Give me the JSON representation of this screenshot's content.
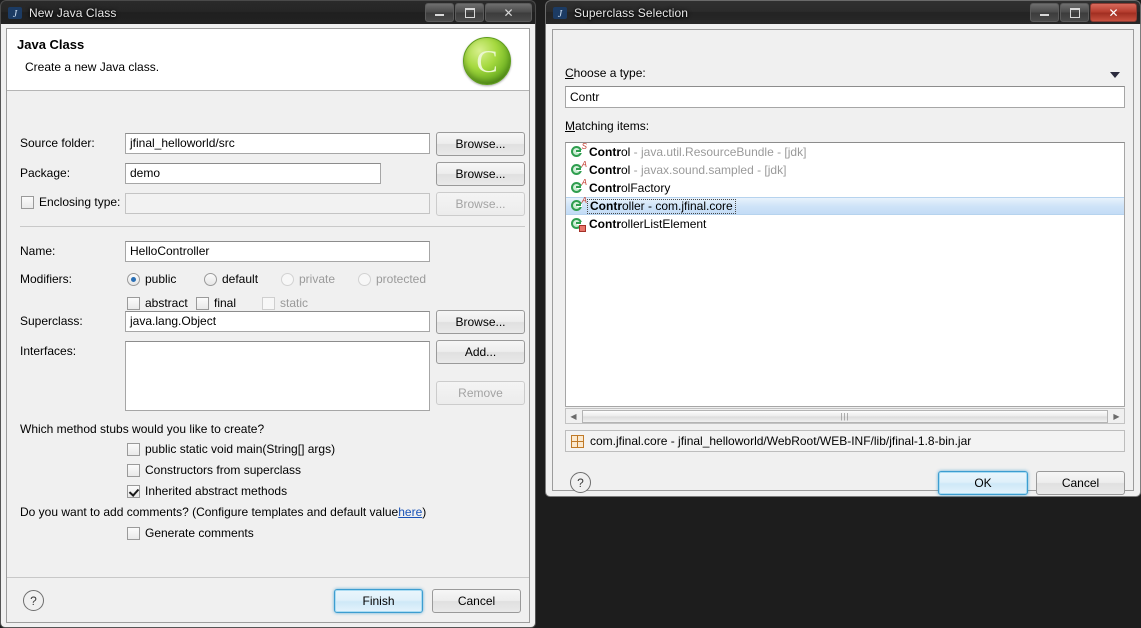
{
  "new_class_dialog": {
    "title": "New Java Class",
    "window_icon": "java-wizard-icon",
    "buttons": {
      "minimize": "minimize-icon",
      "maximize": "maximize-icon",
      "close": "close-icon"
    },
    "header": {
      "title": "Java Class",
      "subtitle": "Create a new Java class.",
      "logo": "java-class-logo"
    },
    "fields": {
      "source_folder": {
        "label": "Source folder:",
        "value": "jfinal_helloworld/src",
        "browse": "Browse..."
      },
      "package": {
        "label": "Package:",
        "value": "demo",
        "browse": "Browse..."
      },
      "enclosing_type": {
        "label": "Enclosing type:",
        "value": "",
        "checked": false,
        "browse": "Browse..."
      },
      "name": {
        "label": "Name:",
        "value": "HelloController"
      },
      "superclass": {
        "label": "Superclass:",
        "value": "java.lang.Object",
        "browse": "Browse..."
      },
      "interfaces": {
        "label": "Interfaces:",
        "value": "",
        "add": "Add...",
        "remove": "Remove"
      }
    },
    "modifiers": {
      "label": "Modifiers:",
      "radios": [
        {
          "label": "public",
          "checked": true,
          "disabled": false
        },
        {
          "label": "default",
          "checked": false,
          "disabled": false
        },
        {
          "label": "private",
          "checked": false,
          "disabled": true
        },
        {
          "label": "protected",
          "checked": false,
          "disabled": true
        }
      ],
      "checkboxes": [
        {
          "label": "abstract",
          "checked": false,
          "disabled": false
        },
        {
          "label": "final",
          "checked": false,
          "disabled": false
        },
        {
          "label": "static",
          "checked": false,
          "disabled": true
        }
      ]
    },
    "method_stubs": {
      "question": "Which method stubs would you like to create?",
      "options": [
        {
          "label": "public static void main(String[] args)",
          "checked": false
        },
        {
          "label": "Constructors from superclass",
          "checked": false
        },
        {
          "label": "Inherited abstract methods",
          "checked": true
        }
      ]
    },
    "comments": {
      "question_prefix": "Do you want to add comments? (Configure templates and default value ",
      "link": "here",
      "question_suffix": ")",
      "option": {
        "label": "Generate comments",
        "checked": false
      }
    },
    "footer": {
      "help": "help-icon",
      "finish": "Finish",
      "cancel": "Cancel"
    }
  },
  "superclass_dialog": {
    "title": "Superclass Selection",
    "window_icon": "java-wizard-icon",
    "buttons": {
      "minimize": "minimize-icon",
      "maximize": "maximize-icon",
      "close": "close-icon"
    },
    "choose_type": {
      "label": "Choose a type:",
      "mnemonic": "C",
      "dropdown": "chevron-down-icon",
      "value": "Contr",
      "placeholder": ""
    },
    "matching_items": {
      "label": "Matching items:",
      "mnemonic": "M",
      "items": [
        {
          "icon": "class-icon",
          "badge": "S",
          "badge_type": "static",
          "match": "Contr",
          "rest": "ol",
          "package": " - java.util.ResourceBundle - [jdk]",
          "selected": false
        },
        {
          "icon": "class-icon",
          "badge": "A",
          "badge_type": "abstract",
          "match": "Contr",
          "rest": "ol",
          "package": " - javax.sound.sampled - [jdk]",
          "selected": false
        },
        {
          "icon": "class-icon",
          "badge": "A",
          "badge_type": "abstract",
          "match": "Contr",
          "rest": "olFactory",
          "package": "",
          "selected": false
        },
        {
          "icon": "class-icon",
          "badge": "A",
          "badge_type": "abstract",
          "match": "Contr",
          "rest": "oller - com.jfinal.core",
          "package": "",
          "selected": true
        },
        {
          "icon": "class-icon-private",
          "badge": "",
          "badge_type": "private",
          "match": "Contr",
          "rest": "ollerListElement",
          "package": "",
          "selected": false
        }
      ]
    },
    "scrollbar": {
      "left_arrow": "chevron-left-icon",
      "right_arrow": "chevron-right-icon",
      "grip": "|||"
    },
    "package_bar": {
      "icon": "package-jar-icon",
      "text": "com.jfinal.core - jfinal_helloworld/WebRoot/WEB-INF/lib/jfinal-1.8-bin.jar"
    },
    "footer": {
      "help": "help-icon",
      "ok": "OK",
      "cancel": "Cancel"
    }
  }
}
